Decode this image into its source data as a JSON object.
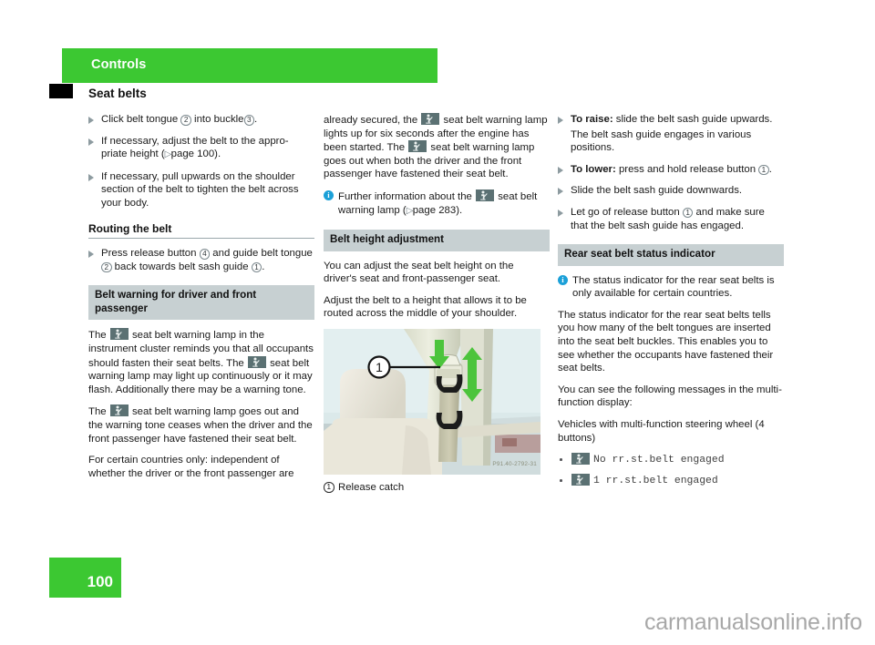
{
  "chapter": {
    "label": "Controls"
  },
  "section": {
    "title": "Seat belts"
  },
  "page": {
    "number": "100"
  },
  "watermark": {
    "text": "carmanualsonline.info"
  },
  "icons": {
    "seatbelt_lamp": "seatbelt-warning-lamp-icon",
    "info": "info-icon",
    "xref_arrow": "cross-reference-arrow-icon",
    "bullet_triangle": "triangle-bullet-icon"
  },
  "colors": {
    "chapter_green": "#3cc832",
    "header_gray": "#c7d0d2",
    "info_blue": "#1ba0d8",
    "lamp_box": "#5b7173",
    "arrow_green": "#4cc43c"
  },
  "column1": {
    "steps": [
      {
        "pre": "Click belt tongue ",
        "ref1": "2",
        "mid": " into buckle",
        "ref2": "3",
        "post": "."
      },
      {
        "text_a": "If necessary, adjust the belt to the appro-priate height (",
        "xref_page": "page 100",
        "text_b": ")."
      },
      {
        "text": "If necessary, pull upwards on the shoulder section of the belt to tighten the belt across your body."
      }
    ],
    "subhead": "Routing the belt",
    "routing_step": {
      "pre": "Press release button ",
      "ref1": "4",
      "mid": " and guide belt tongue ",
      "ref2": "2",
      "post": " back towards belt sash guide ",
      "ref3": "1",
      "end": "."
    },
    "warning_header": "Belt warning for driver and front passenger",
    "warning_p1_a": "The ",
    "warning_p1_b": " seat belt warning lamp in the instrument cluster reminds you that all occupants should fasten their seat belts. The ",
    "warning_p1_c": " seat belt warning lamp may light up continuously or it may flash. Additionally there may be a warning tone.",
    "warning_p2_a": "The ",
    "warning_p2_b": " seat belt warning lamp goes out and the warning tone ceases when the driver and the front passenger have fastened their seat belt.",
    "warning_p3": "For certain countries only: independent of whether the driver or the front passenger are"
  },
  "column2": {
    "cont_a": "already secured, the ",
    "cont_b": " seat belt warning lamp lights up for six seconds after the engine has been started. The ",
    "cont_c": " seat belt warning lamp goes out when both the driver and the front passenger have fastened their seat belt.",
    "note_a": "Further information about the ",
    "note_b": " seat belt warning lamp (",
    "note_xref": "page 283",
    "note_c": ").",
    "height_header": "Belt height adjustment",
    "height_p1": "You can adjust the seat belt height on the driver's seat and front-passenger seat.",
    "height_p2": "Adjust the belt to a height that allows it to be routed across the middle of your shoulder.",
    "figure_callout": "1",
    "figure_credit": "P91.40-2792-31",
    "caption_ref": "1",
    "caption_text": "Release catch"
  },
  "column3": {
    "steps": [
      {
        "bold": "To raise:",
        "text": " slide the belt sash guide upwards."
      },
      {
        "text": "The belt sash guide engages in various positions.",
        "continuation": true
      },
      {
        "bold": "To lower:",
        "text": " press and hold release button ",
        "ref": "1",
        "post": "."
      },
      {
        "text": "Slide the belt sash guide downwards."
      },
      {
        "text": "Let go of release button ",
        "ref": "1",
        "post": " and make sure that the belt sash guide has engaged."
      }
    ],
    "rear_header": "Rear seat belt status indicator",
    "rear_note": "The status indicator for the rear seat belts is only available for certain countries.",
    "rear_p1": "The status indicator for the rear seat belts tells you how many of the belt tongues are inserted into the seat belt buckles. This enables you to see whether the occupants have fastened their seat belts.",
    "rear_p2": "You can see the following messages in the multi-function display:",
    "rear_p3": "Vehicles with multi-function steering wheel (4 buttons)",
    "messages": [
      "No rr.st.belt engaged",
      "1 rr.st.belt engaged"
    ]
  }
}
